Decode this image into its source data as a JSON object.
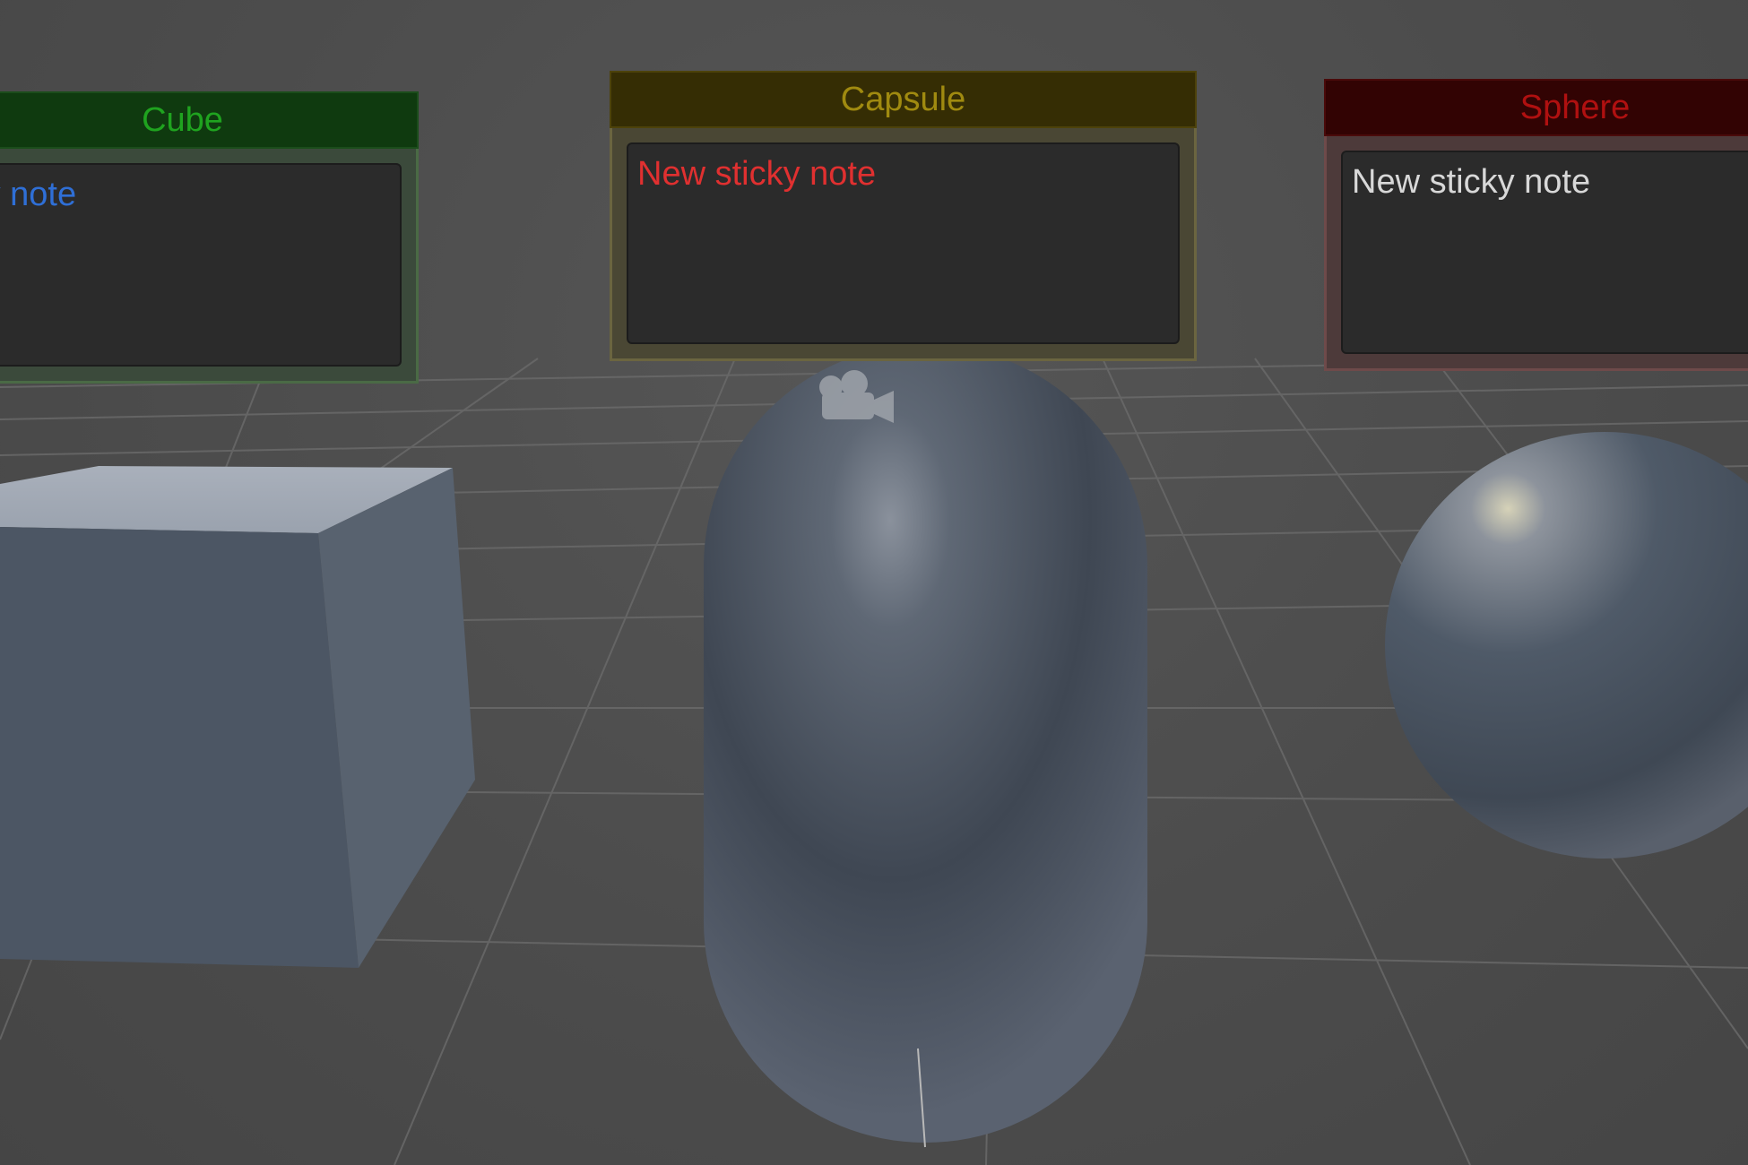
{
  "notes": {
    "cube": {
      "title": "Cube",
      "text": "New sticky note",
      "title_color": "#1fa31f",
      "text_color": "#2f6fd6"
    },
    "capsule": {
      "title": "Capsule",
      "text": "New sticky note",
      "title_color": "#a08a10",
      "text_color": "#e03030"
    },
    "sphere": {
      "title": "Sphere",
      "text": "New sticky note",
      "title_color": "#b01010",
      "text_color": "#d8d8d8"
    }
  },
  "scene": {
    "objects": [
      "cube",
      "capsule",
      "sphere"
    ],
    "gizmo": "camera-icon"
  }
}
